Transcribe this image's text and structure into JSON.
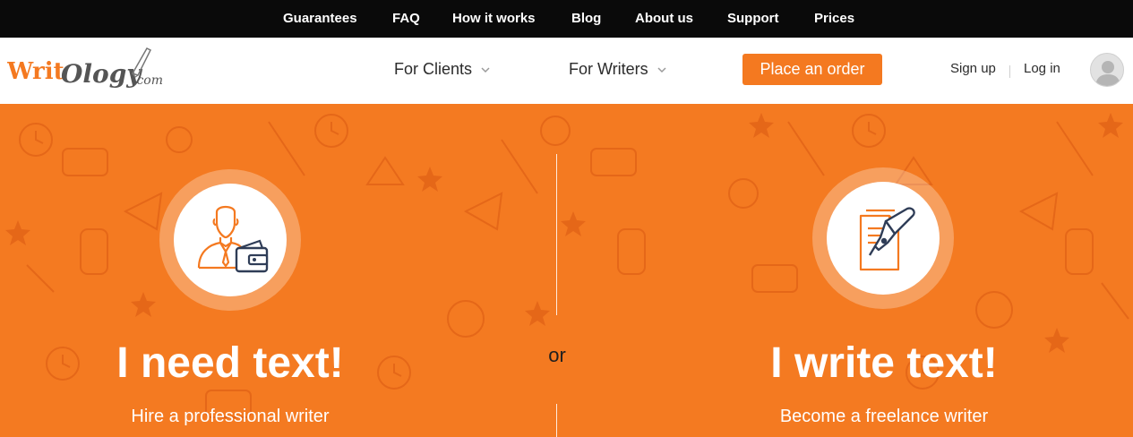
{
  "topnav": {
    "items": [
      "Guarantees",
      "FAQ",
      "How it works",
      "Blog",
      "About us",
      "Support",
      "Prices"
    ]
  },
  "header": {
    "logo_text": "WritOlogy.com",
    "for_clients": "For Clients",
    "for_writers": "For Writers",
    "place_order": "Place an order",
    "sign_up": "Sign up",
    "log_in": "Log in"
  },
  "hero": {
    "left": {
      "title": "I need text!",
      "subtitle": "Hire a professional writer",
      "icon": "client-wallet-icon"
    },
    "or": "or",
    "right": {
      "title": "I write text!",
      "subtitle": "Become a freelance writer",
      "icon": "document-pen-icon"
    }
  },
  "colors": {
    "accent": "#f47920",
    "topbar": "#0a0a0a",
    "hero_bg": "#f47a21",
    "icon_navy": "#2f3d57"
  }
}
